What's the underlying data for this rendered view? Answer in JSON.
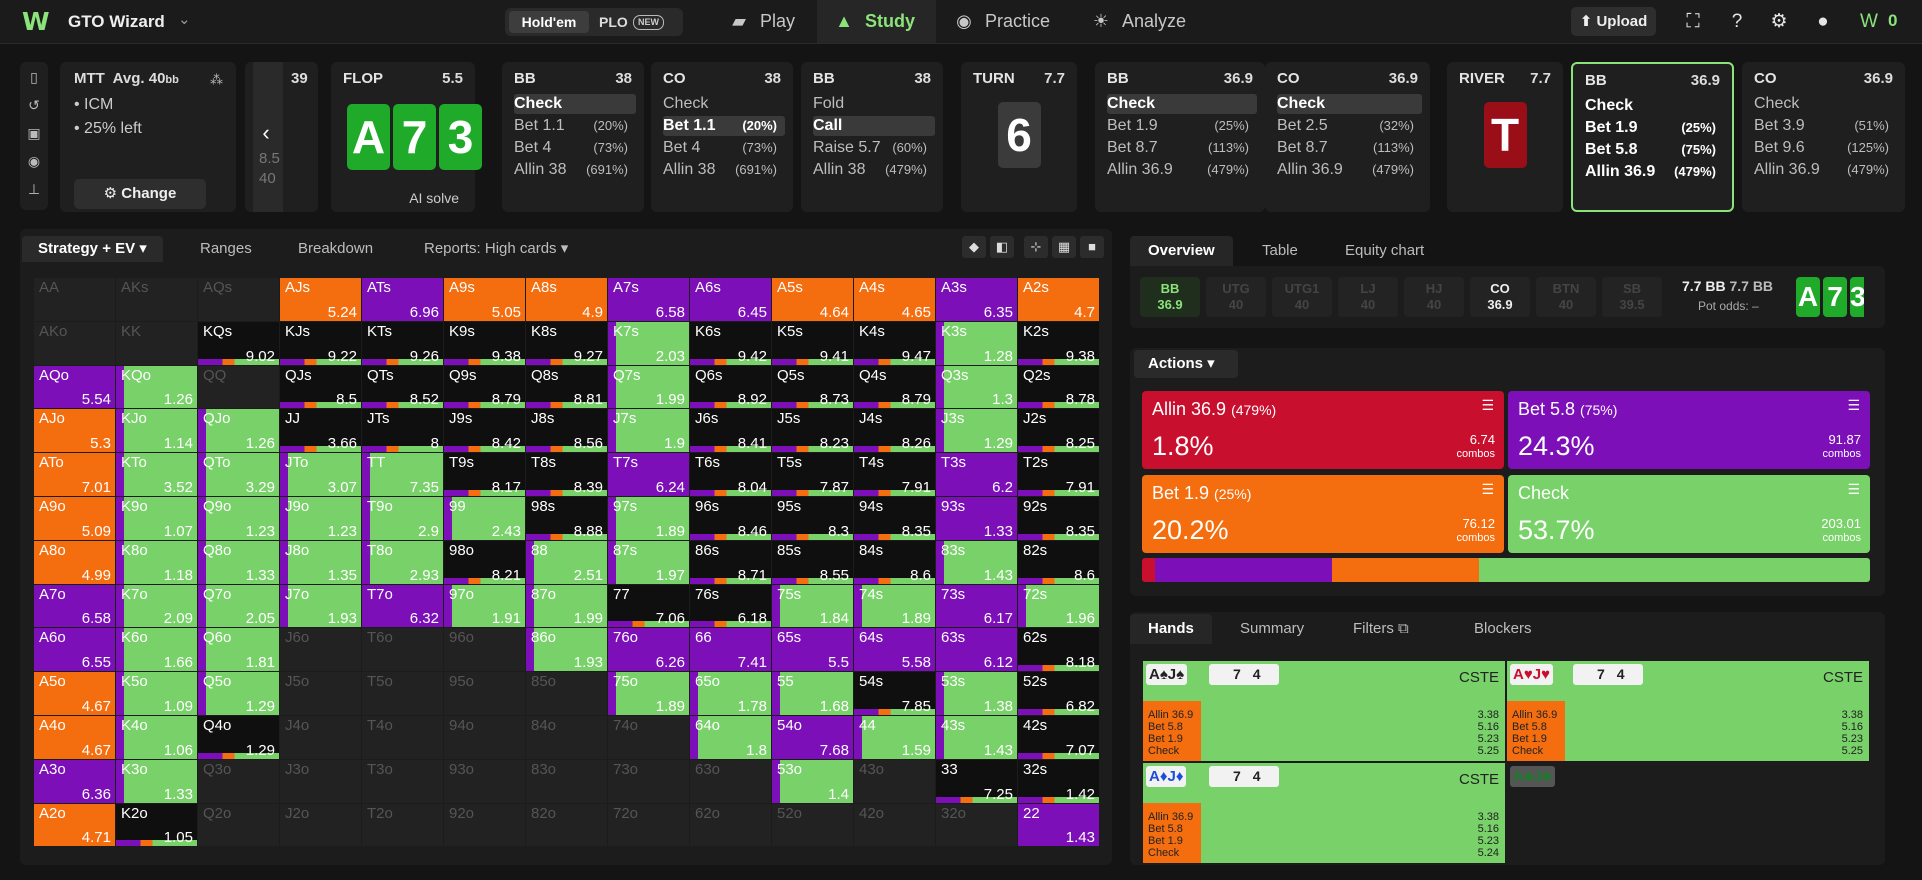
{
  "app": {
    "name": "GTO Wizard",
    "tabs": {
      "holdem": "Hold'em",
      "plo": "PLO",
      "plo_badge": "NEW"
    },
    "nav": {
      "play": "Play",
      "study": "Study",
      "practice": "Practice",
      "analyze": "Analyze"
    },
    "upload": "Upload",
    "credits": "0",
    "accent": "#8be37a"
  },
  "config": {
    "format": "MTT",
    "avg_label": "Avg. 40",
    "avg_unit": "bb",
    "items": [
      "ICM",
      "25% left"
    ],
    "change": "Change"
  },
  "preflop_stub": {
    "value": "39",
    "a": "8.5",
    "b": "40"
  },
  "streets": [
    {
      "hd": "FLOP",
      "pot": "5.5",
      "cards": [
        "A",
        "7",
        "3"
      ],
      "solve": "AI solve"
    },
    {
      "hd": "BB",
      "pot": "38",
      "rows": [
        {
          "l": "Check",
          "p": "",
          "s": "sel"
        },
        {
          "l": "Bet 1.1",
          "p": "(20%)"
        },
        {
          "l": "Bet 4",
          "p": "(73%)"
        },
        {
          "l": "Allin 38",
          "p": "(691%)"
        }
      ]
    },
    {
      "hd": "CO",
      "pot": "38",
      "rows": [
        {
          "l": "Check",
          "p": ""
        },
        {
          "l": "Bet 1.1",
          "p": "(20%)",
          "s": "sel"
        },
        {
          "l": "Bet 4",
          "p": "(73%)"
        },
        {
          "l": "Allin 38",
          "p": "(691%)"
        }
      ]
    },
    {
      "hd": "BB",
      "pot": "38",
      "rows": [
        {
          "l": "Fold",
          "p": ""
        },
        {
          "l": "Call",
          "p": "",
          "s": "sel"
        },
        {
          "l": "Raise 5.7",
          "p": "(60%)"
        },
        {
          "l": "Allin 38",
          "p": "(479%)"
        }
      ]
    },
    {
      "hd": "TURN",
      "pot": "7.7",
      "cards": [
        "6"
      ]
    },
    {
      "hd": "BB",
      "pot": "36.9",
      "rows": [
        {
          "l": "Check",
          "p": "",
          "s": "sel"
        },
        {
          "l": "Bet 1.9",
          "p": "(25%)"
        },
        {
          "l": "Bet 8.7",
          "p": "(113%)"
        },
        {
          "l": "Allin 36.9",
          "p": "(479%)"
        }
      ]
    },
    {
      "hd": "CO",
      "pot": "36.9",
      "rows": [
        {
          "l": "Check",
          "p": "",
          "s": "sel"
        },
        {
          "l": "Bet 2.5",
          "p": "(32%)"
        },
        {
          "l": "Bet 8.7",
          "p": "(113%)"
        },
        {
          "l": "Allin 36.9",
          "p": "(479%)"
        }
      ]
    },
    {
      "hd": "RIVER",
      "pot": "7.7",
      "cards": [
        "T"
      ]
    },
    {
      "hd": "BB",
      "pot": "36.9",
      "rows": [
        {
          "l": "Check",
          "p": "",
          "s": "bold"
        },
        {
          "l": "Bet 1.9",
          "p": "(25%)",
          "s": "bold"
        },
        {
          "l": "Bet 5.8",
          "p": "(75%)",
          "s": "bold"
        },
        {
          "l": "Allin 36.9",
          "p": "(479%)",
          "s": "bold"
        }
      ]
    },
    {
      "hd": "CO",
      "pot": "36.9",
      "rows": [
        {
          "l": "Check",
          "p": ""
        },
        {
          "l": "Bet 3.9",
          "p": "(51%)"
        },
        {
          "l": "Bet 9.6",
          "p": "(125%)"
        },
        {
          "l": "Allin 36.9",
          "p": "(479%)"
        }
      ]
    }
  ],
  "left_tabs": {
    "strategy": "Strategy + EV",
    "ranges": "Ranges",
    "breakdown": "Breakdown",
    "reports": "Reports: High cards"
  },
  "colors": {
    "green": "#78d169",
    "purple": "#7c0fb8",
    "orange": "#f46d0e",
    "red": "#c8102e"
  },
  "grid": [
    [
      [
        "AA",
        "",
        "e"
      ],
      [
        "AKs",
        "",
        "e"
      ],
      [
        "AQs",
        "",
        "e"
      ],
      [
        "AJs",
        "5.24",
        "o"
      ],
      [
        "ATs",
        "6.96",
        "p"
      ],
      [
        "A9s",
        "5.05",
        "o"
      ],
      [
        "A8s",
        "4.9",
        "o"
      ],
      [
        "A7s",
        "6.58",
        "p"
      ],
      [
        "A6s",
        "6.45",
        "p"
      ],
      [
        "A5s",
        "4.64",
        "o"
      ],
      [
        "A4s",
        "4.65",
        "o"
      ],
      [
        "A3s",
        "6.35",
        "p"
      ],
      [
        "A2s",
        "4.7",
        "o"
      ]
    ],
    [
      [
        "AKo",
        "",
        "e"
      ],
      [
        "KK",
        "",
        "e"
      ],
      [
        "KQs",
        "9.02",
        "k"
      ],
      [
        "KJs",
        "9.22",
        "k"
      ],
      [
        "KTs",
        "9.26",
        "k"
      ],
      [
        "K9s",
        "9.38",
        "k"
      ],
      [
        "K8s",
        "9.27",
        "k"
      ],
      [
        "K7s",
        "2.03",
        "g"
      ],
      [
        "K6s",
        "9.42",
        "k"
      ],
      [
        "K5s",
        "9.41",
        "k"
      ],
      [
        "K4s",
        "9.47",
        "k"
      ],
      [
        "K3s",
        "1.28",
        "g"
      ],
      [
        "K2s",
        "9.38",
        "k"
      ]
    ],
    [
      [
        "AQo",
        "5.54",
        "p"
      ],
      [
        "KQo",
        "1.26",
        "g"
      ],
      [
        "QQ",
        "",
        "e"
      ],
      [
        "QJs",
        "8.5",
        "k"
      ],
      [
        "QTs",
        "8.52",
        "k"
      ],
      [
        "Q9s",
        "8.79",
        "k"
      ],
      [
        "Q8s",
        "8.81",
        "k"
      ],
      [
        "Q7s",
        "1.99",
        "g"
      ],
      [
        "Q6s",
        "8.92",
        "k"
      ],
      [
        "Q5s",
        "8.73",
        "k"
      ],
      [
        "Q4s",
        "8.79",
        "k"
      ],
      [
        "Q3s",
        "1.3",
        "g"
      ],
      [
        "Q2s",
        "8.78",
        "k"
      ]
    ],
    [
      [
        "AJo",
        "5.3",
        "o"
      ],
      [
        "KJo",
        "1.14",
        "g"
      ],
      [
        "QJo",
        "1.26",
        "g"
      ],
      [
        "JJ",
        "3.66",
        "k"
      ],
      [
        "JTs",
        "8",
        "k"
      ],
      [
        "J9s",
        "8.42",
        "k"
      ],
      [
        "J8s",
        "8.56",
        "k"
      ],
      [
        "J7s",
        "1.9",
        "g"
      ],
      [
        "J6s",
        "8.41",
        "k"
      ],
      [
        "J5s",
        "8.23",
        "k"
      ],
      [
        "J4s",
        "8.26",
        "k"
      ],
      [
        "J3s",
        "1.29",
        "g"
      ],
      [
        "J2s",
        "8.25",
        "k"
      ]
    ],
    [
      [
        "ATo",
        "7.01",
        "o"
      ],
      [
        "KTo",
        "3.52",
        "g"
      ],
      [
        "QTo",
        "3.29",
        "g"
      ],
      [
        "JTo",
        "3.07",
        "g"
      ],
      [
        "TT",
        "7.35",
        "g"
      ],
      [
        "T9s",
        "8.17",
        "k"
      ],
      [
        "T8s",
        "8.39",
        "k"
      ],
      [
        "T7s",
        "6.24",
        "p"
      ],
      [
        "T6s",
        "8.04",
        "k"
      ],
      [
        "T5s",
        "7.87",
        "k"
      ],
      [
        "T4s",
        "7.91",
        "k"
      ],
      [
        "T3s",
        "6.2",
        "p"
      ],
      [
        "T2s",
        "7.91",
        "k"
      ]
    ],
    [
      [
        "A9o",
        "5.09",
        "o"
      ],
      [
        "K9o",
        "1.07",
        "g"
      ],
      [
        "Q9o",
        "1.23",
        "g"
      ],
      [
        "J9o",
        "1.23",
        "g"
      ],
      [
        "T9o",
        "2.9",
        "g"
      ],
      [
        "99",
        "2.43",
        "g"
      ],
      [
        "98s",
        "8.88",
        "k"
      ],
      [
        "97s",
        "1.89",
        "g"
      ],
      [
        "96s",
        "8.46",
        "k"
      ],
      [
        "95s",
        "8.3",
        "k"
      ],
      [
        "94s",
        "8.35",
        "k"
      ],
      [
        "93s",
        "1.33",
        "p"
      ],
      [
        "92s",
        "8.35",
        "k"
      ]
    ],
    [
      [
        "A8o",
        "4.99",
        "o"
      ],
      [
        "K8o",
        "1.18",
        "g"
      ],
      [
        "Q8o",
        "1.33",
        "g"
      ],
      [
        "J8o",
        "1.35",
        "g"
      ],
      [
        "T8o",
        "2.93",
        "g"
      ],
      [
        "98o",
        "8.21",
        "k"
      ],
      [
        "88",
        "2.51",
        "g"
      ],
      [
        "87s",
        "1.97",
        "g"
      ],
      [
        "86s",
        "8.71",
        "k"
      ],
      [
        "85s",
        "8.55",
        "k"
      ],
      [
        "84s",
        "8.6",
        "k"
      ],
      [
        "83s",
        "1.43",
        "g"
      ],
      [
        "82s",
        "8.6",
        "k"
      ]
    ],
    [
      [
        "A7o",
        "6.58",
        "p"
      ],
      [
        "K7o",
        "2.09",
        "g"
      ],
      [
        "Q7o",
        "2.05",
        "g"
      ],
      [
        "J7o",
        "1.93",
        "g"
      ],
      [
        "T7o",
        "6.32",
        "p"
      ],
      [
        "97o",
        "1.91",
        "g"
      ],
      [
        "87o",
        "1.99",
        "g"
      ],
      [
        "77",
        "7.06",
        "k"
      ],
      [
        "76s",
        "6.18",
        "k"
      ],
      [
        "75s",
        "1.84",
        "g"
      ],
      [
        "74s",
        "1.89",
        "g"
      ],
      [
        "73s",
        "6.17",
        "p"
      ],
      [
        "72s",
        "1.96",
        "g"
      ]
    ],
    [
      [
        "A6o",
        "6.55",
        "p"
      ],
      [
        "K6o",
        "1.66",
        "g"
      ],
      [
        "Q6o",
        "1.81",
        "g"
      ],
      [
        "J6o",
        "",
        "e"
      ],
      [
        "T6o",
        "",
        "e"
      ],
      [
        "96o",
        "",
        "e"
      ],
      [
        "86o",
        "1.93",
        "g"
      ],
      [
        "76o",
        "6.26",
        "p"
      ],
      [
        "66",
        "7.41",
        "p"
      ],
      [
        "65s",
        "5.5",
        "p"
      ],
      [
        "64s",
        "5.58",
        "p"
      ],
      [
        "63s",
        "6.12",
        "p"
      ],
      [
        "62s",
        "8.18",
        "k"
      ]
    ],
    [
      [
        "A5o",
        "4.67",
        "o"
      ],
      [
        "K5o",
        "1.09",
        "g"
      ],
      [
        "Q5o",
        "1.29",
        "g"
      ],
      [
        "J5o",
        "",
        "e"
      ],
      [
        "T5o",
        "",
        "e"
      ],
      [
        "95o",
        "",
        "e"
      ],
      [
        "85o",
        "",
        "e"
      ],
      [
        "75o",
        "1.89",
        "g"
      ],
      [
        "65o",
        "1.78",
        "g"
      ],
      [
        "55",
        "1.68",
        "g"
      ],
      [
        "54s",
        "7.85",
        "k"
      ],
      [
        "53s",
        "1.38",
        "g"
      ],
      [
        "52s",
        "6.82",
        "k"
      ]
    ],
    [
      [
        "A4o",
        "4.67",
        "o"
      ],
      [
        "K4o",
        "1.06",
        "g"
      ],
      [
        "Q4o",
        "1.29",
        "k"
      ],
      [
        "J4o",
        "",
        "e"
      ],
      [
        "T4o",
        "",
        "e"
      ],
      [
        "94o",
        "",
        "e"
      ],
      [
        "84o",
        "",
        "e"
      ],
      [
        "74o",
        "",
        "e"
      ],
      [
        "64o",
        "1.8",
        "g"
      ],
      [
        "54o",
        "7.68",
        "p"
      ],
      [
        "44",
        "1.59",
        "g"
      ],
      [
        "43s",
        "1.43",
        "g"
      ],
      [
        "42s",
        "7.07",
        "k"
      ]
    ],
    [
      [
        "A3o",
        "6.36",
        "p"
      ],
      [
        "K3o",
        "1.33",
        "g"
      ],
      [
        "Q3o",
        "",
        "e"
      ],
      [
        "J3o",
        "",
        "e"
      ],
      [
        "T3o",
        "",
        "e"
      ],
      [
        "93o",
        "",
        "e"
      ],
      [
        "83o",
        "",
        "e"
      ],
      [
        "73o",
        "",
        "e"
      ],
      [
        "63o",
        "",
        "e"
      ],
      [
        "53o",
        "1.4",
        "g"
      ],
      [
        "43o",
        "",
        "e"
      ],
      [
        "33",
        "7.25",
        "k"
      ],
      [
        "32s",
        "1.42",
        "k"
      ]
    ],
    [
      [
        "A2o",
        "4.71",
        "o"
      ],
      [
        "K2o",
        "1.05",
        "k"
      ],
      [
        "Q2o",
        "",
        "e"
      ],
      [
        "J2o",
        "",
        "e"
      ],
      [
        "T2o",
        "",
        "e"
      ],
      [
        "92o",
        "",
        "e"
      ],
      [
        "82o",
        "",
        "e"
      ],
      [
        "72o",
        "",
        "e"
      ],
      [
        "62o",
        "",
        "e"
      ],
      [
        "52o",
        "",
        "e"
      ],
      [
        "42o",
        "",
        "e"
      ],
      [
        "32o",
        "",
        "e"
      ],
      [
        "22",
        "1.43",
        "p"
      ]
    ]
  ],
  "right_tabs": {
    "overview": "Overview",
    "table": "Table",
    "equity": "Equity chart"
  },
  "positions": [
    {
      "n": "BB",
      "s": "36.9",
      "c": "bb"
    },
    {
      "n": "UTG",
      "s": "40"
    },
    {
      "n": "UTG1",
      "s": "40"
    },
    {
      "n": "LJ",
      "s": "40"
    },
    {
      "n": "HJ",
      "s": "40"
    },
    {
      "n": "CO",
      "s": "36.9",
      "c": "on"
    },
    {
      "n": "BTN",
      "s": "40"
    },
    {
      "n": "SB",
      "s": "39.5"
    }
  ],
  "pot": {
    "a": "7.7 BB",
    "b": "7.7 BB",
    "odds_label": "Pot odds:",
    "odds_val": "–"
  },
  "actions_label": "Actions",
  "actions": [
    {
      "name": "Allin 36.9",
      "size": "(479%)",
      "freq": "1.8%",
      "combos": "6.74",
      "unit": "combos",
      "color": "#c8102e"
    },
    {
      "name": "Bet 5.8",
      "size": "(75%)",
      "freq": "24.3%",
      "combos": "91.87",
      "unit": "combos",
      "color": "#7c0fb8"
    },
    {
      "name": "Bet 1.9",
      "size": "(25%)",
      "freq": "20.2%",
      "combos": "76.12",
      "unit": "combos",
      "color": "#f46d0e"
    },
    {
      "name": "Check",
      "size": "",
      "freq": "53.7%",
      "combos": "203.01",
      "unit": "combos",
      "color": "#78d169"
    }
  ],
  "bottom_tabs": {
    "hands": "Hands",
    "summary": "Summary",
    "filters": "Filters",
    "blockers": "Blockers"
  },
  "hands": [
    {
      "tag": "A♠J♠",
      "tag_color": "#222",
      "bl": "7",
      "bl2": "4",
      "cste": "CSTE",
      "lines": [
        [
          "Allin 36.9",
          "3.38"
        ],
        [
          "Bet 5.8",
          "5.16"
        ],
        [
          "Bet 1.9",
          "5.23"
        ],
        [
          "Check",
          "5.25"
        ]
      ]
    },
    {
      "tag": "A♥J♥",
      "tag_color": "#c8102e",
      "bl": "7",
      "bl2": "4",
      "cste": "CSTE",
      "lines": [
        [
          "Allin 36.9",
          "3.38"
        ],
        [
          "Bet 5.8",
          "5.16"
        ],
        [
          "Bet 1.9",
          "5.23"
        ],
        [
          "Check",
          "5.25"
        ]
      ]
    },
    {
      "tag": "A♦J♦",
      "tag_color": "#1d4ed8",
      "bl": "7",
      "bl2": "4",
      "cste": "CSTE",
      "lines": [
        [
          "Allin 36.9",
          "3.38"
        ],
        [
          "Bet 5.8",
          "5.16"
        ],
        [
          "Bet 1.9",
          "5.23"
        ],
        [
          "Check",
          "5.24"
        ]
      ]
    },
    {
      "tag": "A♣J♣",
      "tag_color": "#1c7a2d"
    }
  ]
}
